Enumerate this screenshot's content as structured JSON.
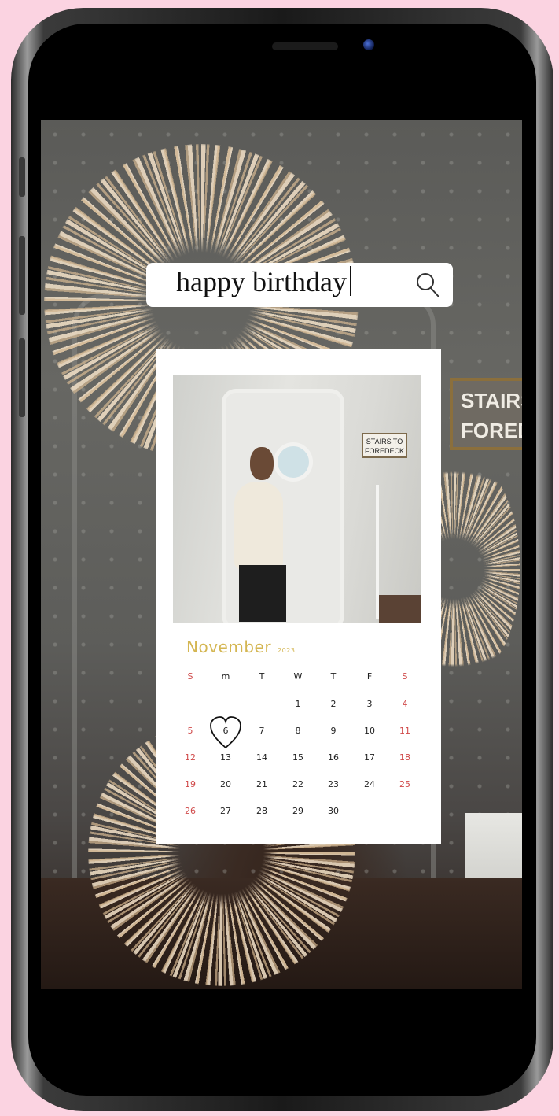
{
  "search": {
    "query": "happy birthday",
    "icon": "search-icon"
  },
  "photo": {
    "sign_line1": "STAIRS TO",
    "sign_line2": "FOREDECK"
  },
  "background": {
    "sign_line1": "STAIRS",
    "sign_line2": "FORED"
  },
  "calendar": {
    "month": "November",
    "year": "2023",
    "weekdays": [
      "S",
      "m",
      "T",
      "W",
      "T",
      "F",
      "S"
    ],
    "weeks": [
      [
        "",
        "",
        "",
        "1",
        "2",
        "3",
        "4"
      ],
      [
        "5",
        "6",
        "7",
        "8",
        "9",
        "10",
        "11"
      ],
      [
        "12",
        "13",
        "14",
        "15",
        "16",
        "17",
        "18"
      ],
      [
        "19",
        "20",
        "21",
        "22",
        "23",
        "24",
        "25"
      ],
      [
        "26",
        "27",
        "28",
        "29",
        "30",
        "",
        ""
      ]
    ],
    "highlighted_day": "6",
    "highlight_icon": "heart-icon",
    "colors": {
      "month": "#d4b652",
      "weekend": "#d04a4a"
    }
  }
}
